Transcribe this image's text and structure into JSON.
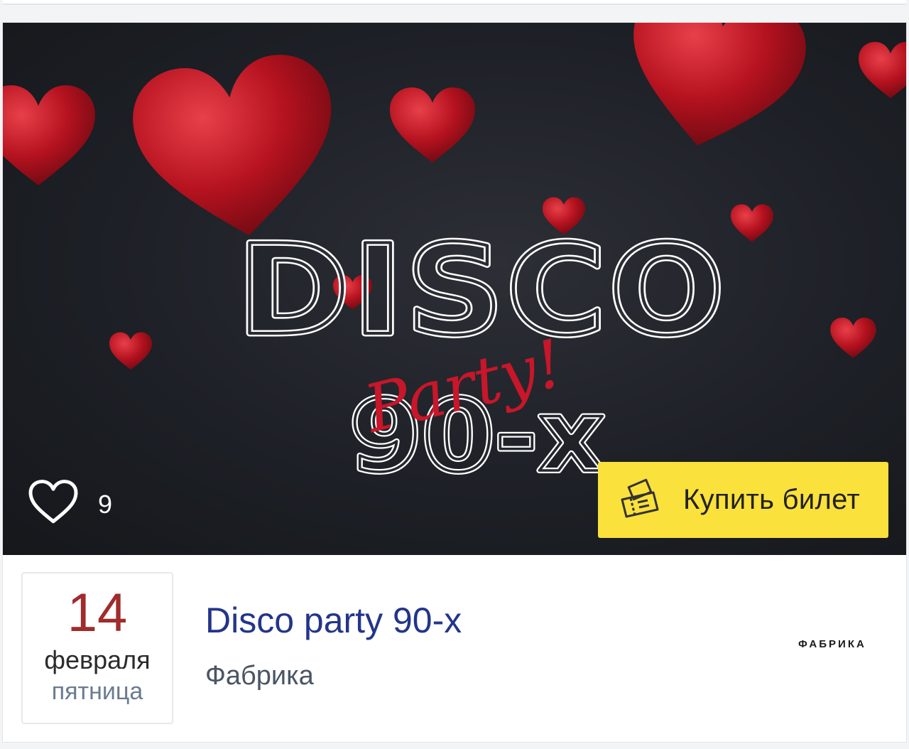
{
  "banner": {
    "poster_alt": "Disco party 90-х poster",
    "disco_text": "DISCO",
    "party_text": "Party!",
    "decade_text": "90-x"
  },
  "likes": {
    "icon": "heart-outline-icon",
    "count": "9"
  },
  "buy_button": {
    "icon": "ticket-icon",
    "label": "Купить билет",
    "color": "#fbe13c"
  },
  "event": {
    "date": {
      "day": "14",
      "month": "февраля",
      "weekday": "пятница"
    },
    "title": "Disco party 90-х",
    "venue": "Фабрика",
    "venue_logo": "ФАБРИКА"
  }
}
